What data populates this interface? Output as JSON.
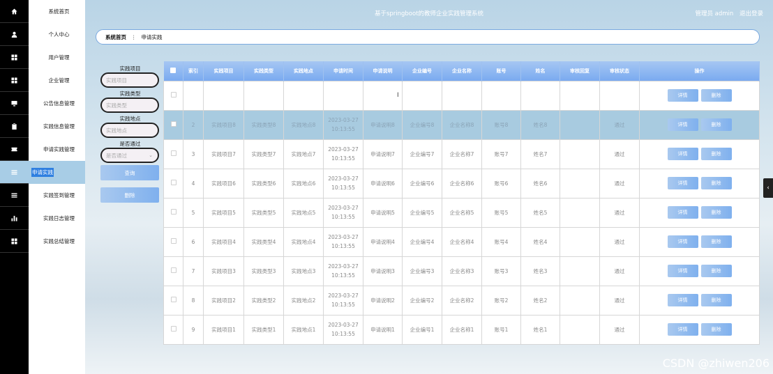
{
  "header": {
    "title": "基于springboot的教师企业实践管理系统",
    "user_label": "管理员 admin",
    "logout": "退出登录"
  },
  "sidebar": {
    "icons": [
      "home-icon",
      "user-icon",
      "grid-icon",
      "grid-icon",
      "monitor-icon",
      "clipboard-icon",
      "ticket-icon",
      "list-icon",
      "list-icon",
      "bar-chart-icon",
      "grid-icon"
    ],
    "items": [
      {
        "label": "系统首页"
      },
      {
        "label": "个人中心"
      },
      {
        "label": "用户管理"
      },
      {
        "label": "企业管理"
      },
      {
        "label": "公告信息管理"
      },
      {
        "label": "实践信息管理"
      },
      {
        "label": "申请实践管理"
      },
      {
        "label": "申请实践"
      },
      {
        "label": "实践签到管理"
      },
      {
        "label": "实践日志管理"
      },
      {
        "label": "实践总结管理"
      }
    ]
  },
  "breadcrumb": {
    "home": "系统首页",
    "sep": "⋮",
    "current": "申请实践"
  },
  "filters": {
    "f1_label": "实践项目",
    "f1_placeholder": "实践项目",
    "f2_label": "实践类型",
    "f2_placeholder": "实践类型",
    "f3_label": "实践地点",
    "f3_placeholder": "实践地点",
    "f4_label": "是否通过",
    "f4_placeholder": "是否通过",
    "query_button": "查询",
    "delete_button": "删除"
  },
  "table": {
    "headers": [
      "索引",
      "实践项目",
      "实践类型",
      "实践地点",
      "申请时间",
      "申请说明",
      "企业编号",
      "企业名称",
      "账号",
      "姓名",
      "审核回复",
      "审核状态",
      "操作"
    ],
    "rows": [
      {
        "index": "",
        "project": "",
        "type": "",
        "place": "",
        "time": "",
        "desc": "",
        "corp_no": "",
        "corp_name": "",
        "account": "",
        "name": "",
        "reply": "",
        "status": ""
      },
      {
        "index": "2",
        "project": "实践项目8",
        "type": "实践类型8",
        "place": "实践地点8",
        "time": "2023-03-27 10:13:55",
        "desc": "申请说明8",
        "corp_no": "企业编号8",
        "corp_name": "企业名称8",
        "account": "账号8",
        "name": "姓名8",
        "reply": "",
        "status": "通过"
      },
      {
        "index": "3",
        "project": "实践项目7",
        "type": "实践类型7",
        "place": "实践地点7",
        "time": "2023-03-27 10:13:55",
        "desc": "申请说明7",
        "corp_no": "企业编号7",
        "corp_name": "企业名称7",
        "account": "账号7",
        "name": "姓名7",
        "reply": "",
        "status": "通过"
      },
      {
        "index": "4",
        "project": "实践项目6",
        "type": "实践类型6",
        "place": "实践地点6",
        "time": "2023-03-27 10:13:55",
        "desc": "申请说明6",
        "corp_no": "企业编号6",
        "corp_name": "企业名称6",
        "account": "账号6",
        "name": "姓名6",
        "reply": "",
        "status": "通过"
      },
      {
        "index": "5",
        "project": "实践项目5",
        "type": "实践类型5",
        "place": "实践地点5",
        "time": "2023-03-27 10:13:55",
        "desc": "申请说明5",
        "corp_no": "企业编号5",
        "corp_name": "企业名称5",
        "account": "账号5",
        "name": "姓名5",
        "reply": "",
        "status": "通过"
      },
      {
        "index": "6",
        "project": "实践项目4",
        "type": "实践类型4",
        "place": "实践地点4",
        "time": "2023-03-27 10:13:55",
        "desc": "申请说明4",
        "corp_no": "企业编号4",
        "corp_name": "企业名称4",
        "account": "账号4",
        "name": "姓名4",
        "reply": "",
        "status": "通过"
      },
      {
        "index": "7",
        "project": "实践项目3",
        "type": "实践类型3",
        "place": "实践地点3",
        "time": "2023-03-27 10:13:55",
        "desc": "申请说明3",
        "corp_no": "企业编号3",
        "corp_name": "企业名称3",
        "account": "账号3",
        "name": "姓名3",
        "reply": "",
        "status": "通过"
      },
      {
        "index": "8",
        "project": "实践项目2",
        "type": "实践类型2",
        "place": "实践地点2",
        "time": "2023-03-27 10:13:55",
        "desc": "申请说明2",
        "corp_no": "企业编号2",
        "corp_name": "企业名称2",
        "account": "账号2",
        "name": "姓名2",
        "reply": "",
        "status": "通过"
      },
      {
        "index": "9",
        "project": "实践项目1",
        "type": "实践类型1",
        "place": "实践地点1",
        "time": "2023-03-27 10:13:55",
        "desc": "申请说明1",
        "corp_no": "企业编号1",
        "corp_name": "企业名称1",
        "account": "账号1",
        "name": "姓名1",
        "reply": "",
        "status": "通过"
      }
    ],
    "detail_button": "详情",
    "delete_button": "删除",
    "selected_row": 1
  },
  "watermark": "CSDN @zhiwen206"
}
